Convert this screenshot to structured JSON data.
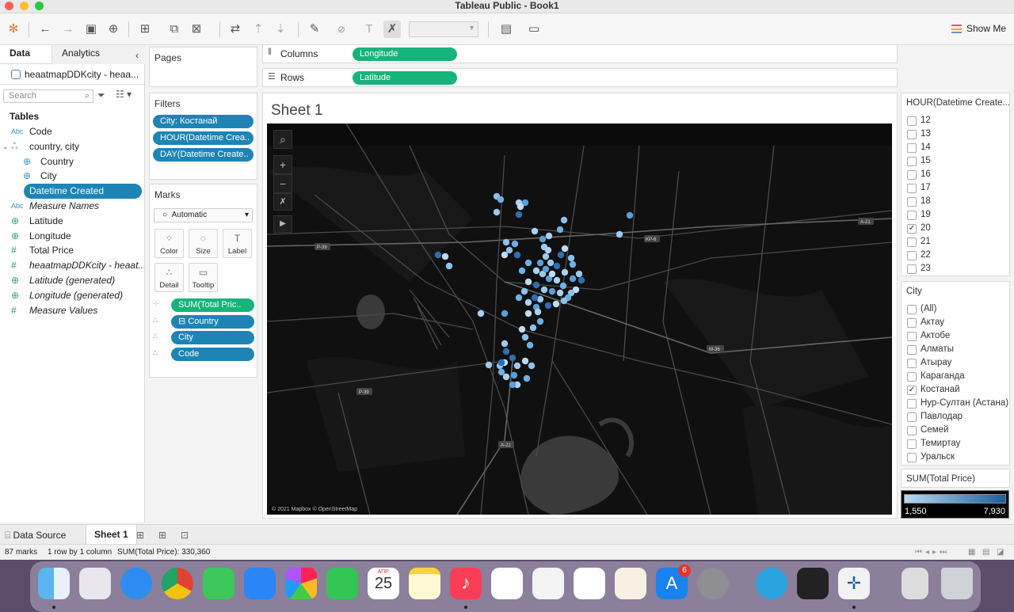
{
  "window": {
    "title": "Tableau Public - Book1"
  },
  "toolbar": {
    "show_me": "Show Me"
  },
  "data_pane": {
    "tab_data": "Data",
    "tab_analytics": "Analytics",
    "datasource": "heaatmapDDKcity - heaa...",
    "search_placeholder": "Search",
    "tables_heading": "Tables",
    "fields": [
      {
        "label": "Code",
        "type": "Abc"
      },
      {
        "label": "country, city",
        "type": "hierarchy"
      },
      {
        "label": "Country",
        "type": "geo"
      },
      {
        "label": "City",
        "type": "geo"
      },
      {
        "label": "Datetime Created",
        "type": "date"
      },
      {
        "label": "Measure Names",
        "type": "Abc"
      },
      {
        "label": "Latitude",
        "type": "geo"
      },
      {
        "label": "Longitude",
        "type": "geo"
      },
      {
        "label": "Total Price",
        "type": "#"
      },
      {
        "label": "heaatmapDDKcity - heaat...",
        "type": "#"
      },
      {
        "label": "Latitude (generated)",
        "type": "geo"
      },
      {
        "label": "Longitude (generated)",
        "type": "geo"
      },
      {
        "label": "Measure Values",
        "type": "#"
      }
    ]
  },
  "pages_card": {
    "title": "Pages"
  },
  "filters_card": {
    "title": "Filters",
    "pills": [
      "City: Костанай",
      "HOUR(Datetime Crea..",
      "DAY(Datetime Create.."
    ]
  },
  "marks_card": {
    "title": "Marks",
    "mark_type": "Automatic",
    "buttons": [
      "Color",
      "Size",
      "Label",
      "Detail",
      "Tooltip"
    ],
    "pills": [
      "SUM(Total Pric..",
      "Country",
      "City",
      "Code"
    ]
  },
  "shelves": {
    "columns_label": "Columns",
    "columns_pill": "Longitude",
    "rows_label": "Rows",
    "rows_pill": "Latitude"
  },
  "sheet": {
    "title": "Sheet 1",
    "map_credit": "© 2021 Mapbox © OpenStreetMap",
    "road_labels": [
      "P-39",
      "KP-6",
      "A-21",
      "M-36",
      "P-39",
      "A-22"
    ]
  },
  "hour_filter": {
    "title": "HOUR(Datetime Create...",
    "items": [
      {
        "label": "12",
        "checked": false
      },
      {
        "label": "13",
        "checked": false
      },
      {
        "label": "14",
        "checked": false
      },
      {
        "label": "15",
        "checked": false
      },
      {
        "label": "16",
        "checked": false
      },
      {
        "label": "17",
        "checked": false
      },
      {
        "label": "18",
        "checked": false
      },
      {
        "label": "19",
        "checked": false
      },
      {
        "label": "20",
        "checked": true
      },
      {
        "label": "21",
        "checked": false
      },
      {
        "label": "22",
        "checked": false
      },
      {
        "label": "23",
        "checked": false
      }
    ]
  },
  "city_filter": {
    "title": "City",
    "items": [
      {
        "label": "(All)",
        "checked": false
      },
      {
        "label": "Актау",
        "checked": false
      },
      {
        "label": "Актобе",
        "checked": false
      },
      {
        "label": "Алматы",
        "checked": false
      },
      {
        "label": "Атырау",
        "checked": false
      },
      {
        "label": "Караганда",
        "checked": false
      },
      {
        "label": "Костанай",
        "checked": true
      },
      {
        "label": "Нур-Султан (Астана)",
        "checked": false
      },
      {
        "label": "Павлодар",
        "checked": false
      },
      {
        "label": "Семей",
        "checked": false
      },
      {
        "label": "Темиртау",
        "checked": false
      },
      {
        "label": "Уральск",
        "checked": false
      }
    ]
  },
  "color_legend": {
    "title": "SUM(Total Price)",
    "min": "1,550",
    "max": "7,930",
    "color_low": "#b9d9f0",
    "color_high": "#1b5fa0"
  },
  "bottom_tabs": {
    "data_source": "Data Source",
    "sheet": "Sheet 1"
  },
  "status": {
    "marks": "87 marks",
    "dims": "1 row by 1 column",
    "sum": "SUM(Total Price): 330,360"
  },
  "dock": {
    "calendar_month": "АПР.",
    "calendar_day": "25",
    "appstore_badge": "6"
  }
}
